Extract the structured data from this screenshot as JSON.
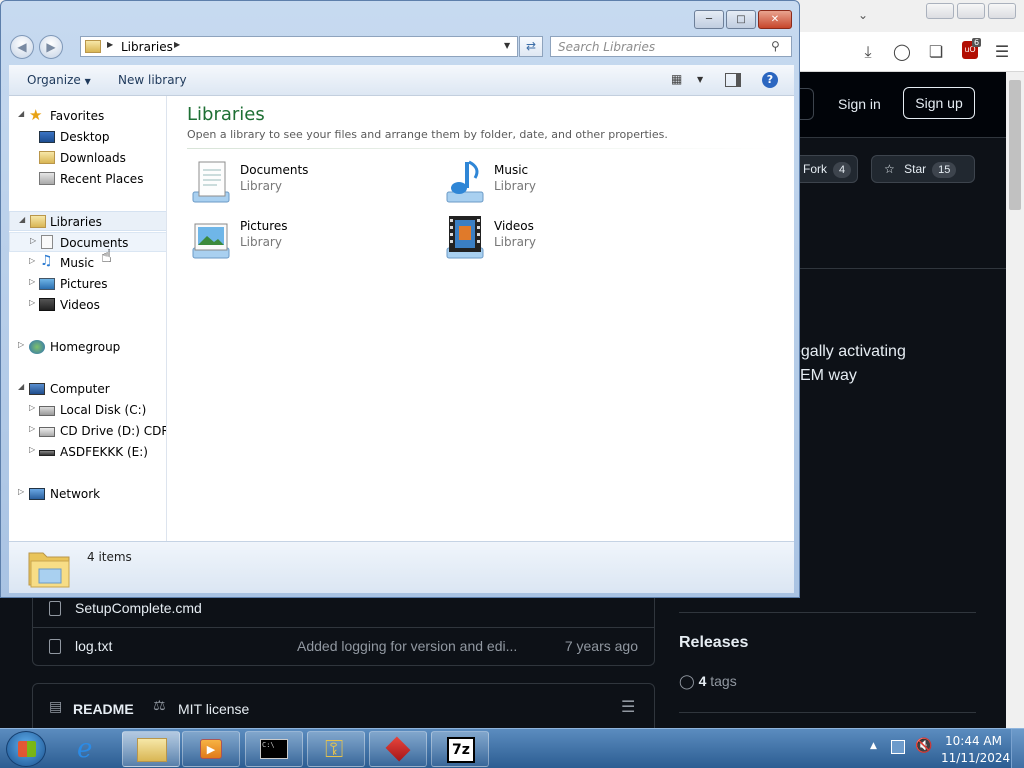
{
  "browser": {
    "toolbar_icons": [
      "download-icon",
      "account-icon",
      "extensions-icon",
      "ublock-icon",
      "menu-icon"
    ],
    "extension_badge_count": "6"
  },
  "github": {
    "sign_in": "Sign in",
    "sign_up": "Sign up",
    "fork_label": "Fork",
    "fork_count": "4",
    "star_label": "Star",
    "star_count": "15",
    "about_line1": "egally activating",
    "about_line2": "EM way",
    "files": [
      {
        "name": "SetupComplete.cmd",
        "message": "",
        "age": ""
      },
      {
        "name": "log.txt",
        "message": "Added logging for version and edi...",
        "age": "7 years ago"
      }
    ],
    "readme_tab": "README",
    "license_tab": "MIT license",
    "releases_title": "Releases",
    "tags_count": "4",
    "tags_label": "tags"
  },
  "explorer": {
    "address_path": "Libraries",
    "search_placeholder": "Search Libraries",
    "commands": {
      "organize": "Organize",
      "new_library": "New library"
    },
    "nav": {
      "favorites": "Favorites",
      "desktop": "Desktop",
      "downloads": "Downloads",
      "recent_places": "Recent Places",
      "libraries": "Libraries",
      "documents": "Documents",
      "music": "Music",
      "pictures": "Pictures",
      "videos": "Videos",
      "homegroup": "Homegroup",
      "computer": "Computer",
      "local_disk": "Local Disk (C:)",
      "cd_drive": "CD Drive (D:) CDROM",
      "usb_drive": "ASDFEKKK (E:)",
      "network": "Network"
    },
    "content": {
      "title": "Libraries",
      "subtitle": "Open a library to see your files and arrange them by folder, date, and other properties.",
      "libraries": [
        {
          "name": "Documents",
          "type": "Library",
          "icon": "documents-library-icon"
        },
        {
          "name": "Music",
          "type": "Library",
          "icon": "music-library-icon"
        },
        {
          "name": "Pictures",
          "type": "Library",
          "icon": "pictures-library-icon"
        },
        {
          "name": "Videos",
          "type": "Library",
          "icon": "videos-library-icon"
        }
      ]
    },
    "details": {
      "item_count": "4 items"
    }
  },
  "taskbar": {
    "apps": [
      "internet-explorer",
      "file-explorer",
      "media-player",
      "command-prompt",
      "keys-tool",
      "red-app",
      "7zip"
    ],
    "time": "10:44 AM",
    "date": "11/11/2024"
  },
  "colors": {
    "library_title": "#1e6f34",
    "github_bg": "#0d1117",
    "taskbar": "#2c5d92"
  }
}
